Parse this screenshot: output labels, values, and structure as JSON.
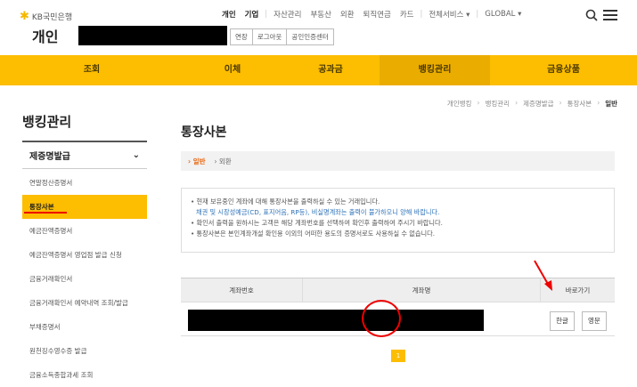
{
  "header": {
    "logo_text": "KB국민은행",
    "brand": "개인",
    "topnav": [
      "개인",
      "기업",
      "자산관리",
      "부동산",
      "외환",
      "퇴직연금",
      "카드",
      "전체서비스 ▾",
      "GLOBAL ▾"
    ],
    "utility": [
      "연장",
      "로그아웃",
      "공인인증센터"
    ]
  },
  "gnb": [
    "조회",
    "이체",
    "공과금",
    "뱅킹관리",
    "금융상품"
  ],
  "breadcrumb": [
    "개인뱅킹",
    "뱅킹관리",
    "제증명발급",
    "통장사본",
    "일반"
  ],
  "sidebar": {
    "title": "뱅킹관리",
    "group": "제증명발급",
    "items": [
      {
        "label": "연말정산증명서"
      },
      {
        "label": "통장사본"
      },
      {
        "label": "예금잔액증명서"
      },
      {
        "label": "예금잔액증명서 영업점 발급 신청"
      },
      {
        "label": "금융거래확인서"
      },
      {
        "label": "금융거래확인서 예약내역 조회/발급"
      },
      {
        "label": "부채증명서"
      },
      {
        "label": "원천징수영수증 발급"
      },
      {
        "label": "금융소득종합과세 조회"
      }
    ]
  },
  "main": {
    "title": "통장사본",
    "tabs": [
      "› 일반",
      "› 외환"
    ],
    "notice": {
      "line1": "• 현재 보유중인 계좌에 대해 통장사본을 출력하실 수 있는 거래입니다.",
      "line1b": "채권 및 시장성예금(CD, 표지어음, RP등), 비실명계좌는 출력이 불가하오니 양해 바랍니다.",
      "line2": "• 확인서 출력을 원하시는 고객은 해당 계좌번호를 선택하여 확인후 출력하여 주시기 바랍니다.",
      "line3": "• 통장사본은 본인계좌개설 확인용 이외의 어떠한 용도의 증명서로도 사용하실 수 없습니다."
    },
    "table": {
      "headers": [
        "계좌번호",
        "계좌명",
        "바로가기"
      ],
      "buttons": [
        "한글",
        "영문"
      ]
    },
    "pager": "1"
  },
  "colors": {
    "accent": "#fdbd00",
    "highlight_red": "#e00000"
  }
}
